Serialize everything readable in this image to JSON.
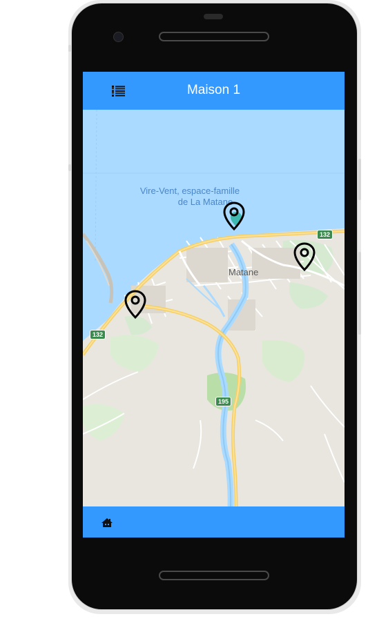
{
  "app": {
    "title": "Maison 1"
  },
  "map": {
    "poi_line1": "Vire-Vent, espace-famille",
    "poi_line2": "de La Matane",
    "city": "Matane",
    "route_132_a": "132",
    "route_132_b": "132",
    "route_195": "195",
    "marker_count": 3
  },
  "icons": {
    "menu": "list-icon",
    "home": "home-icon",
    "marker": "map-marker-icon"
  },
  "colors": {
    "app_bar": "#3399ff",
    "water": "#aadaff",
    "land": "#e9e6df",
    "road": "#f6cf65",
    "marker_stroke": "#000000"
  }
}
